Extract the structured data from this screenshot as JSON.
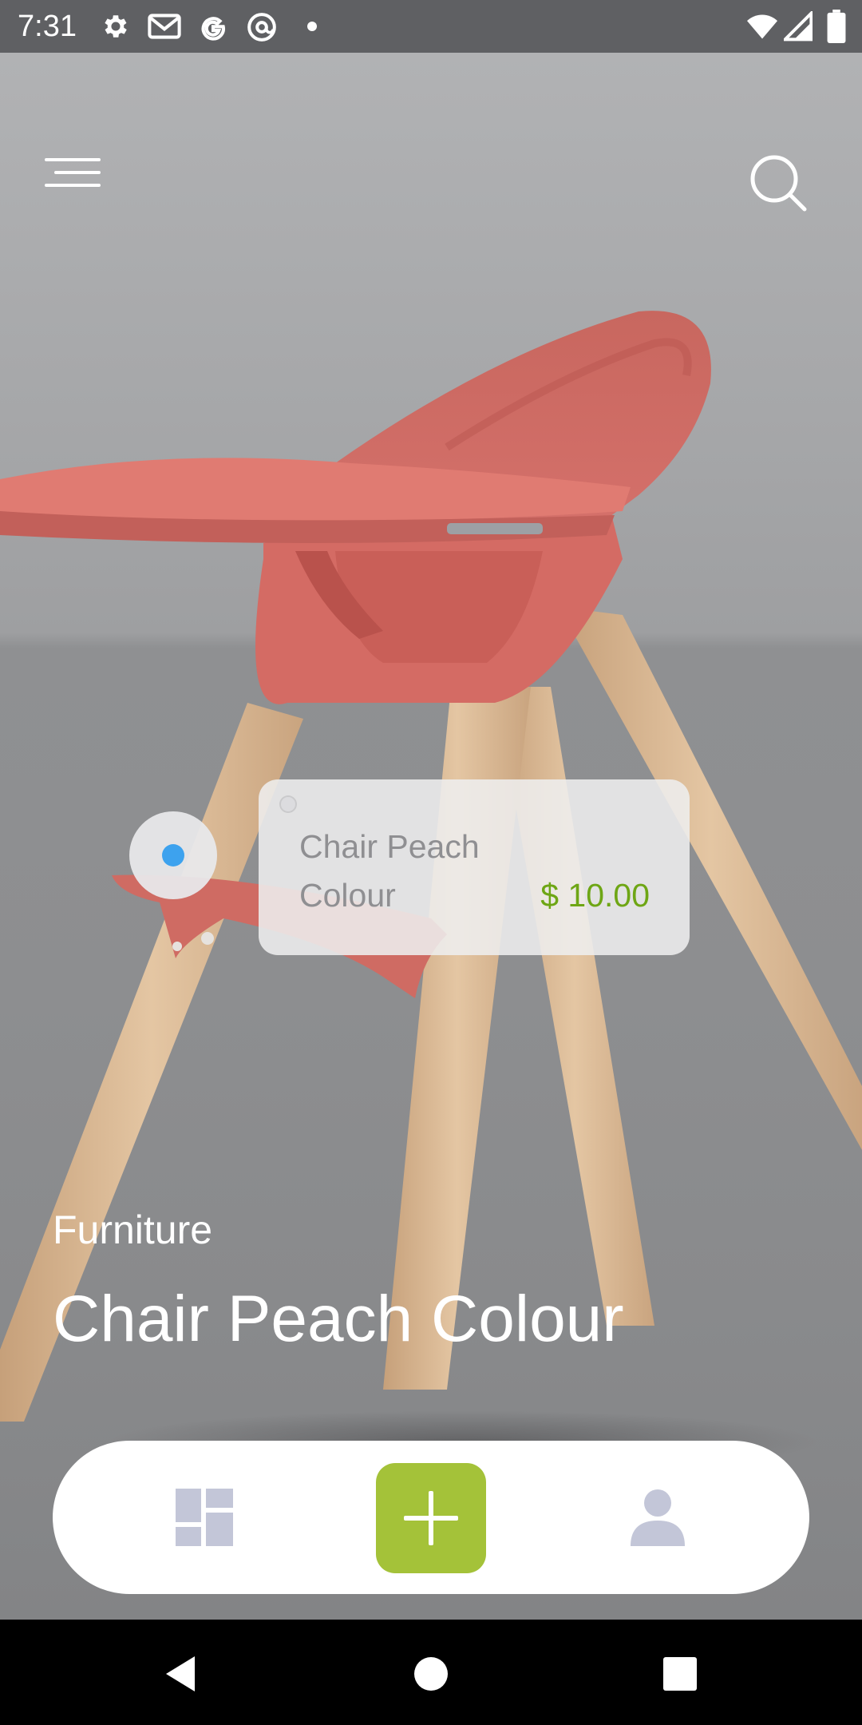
{
  "status_bar": {
    "time": "7:31",
    "icons": [
      "settings-icon",
      "gmail-icon",
      "google-icon",
      "at-sign-icon",
      "dot-icon",
      "wifi-icon",
      "signal-icon",
      "battery-icon"
    ]
  },
  "header": {
    "menu_icon": "menu-icon",
    "search_icon": "search-icon"
  },
  "hotspot": {
    "dot_color": "#3da2ee"
  },
  "tooltip": {
    "name": "Chair Peach Colour",
    "price": "$ 10.00",
    "price_color": "#6ea615"
  },
  "product": {
    "category": "Furniture",
    "title": "Chair Peach Colour"
  },
  "bottom_nav": {
    "items": [
      {
        "icon": "dashboard-icon"
      },
      {
        "icon": "plus-icon",
        "accent": "#a4c239"
      },
      {
        "icon": "person-icon"
      }
    ]
  },
  "system_nav": {
    "items": [
      "back-icon",
      "home-icon",
      "recents-icon"
    ]
  }
}
